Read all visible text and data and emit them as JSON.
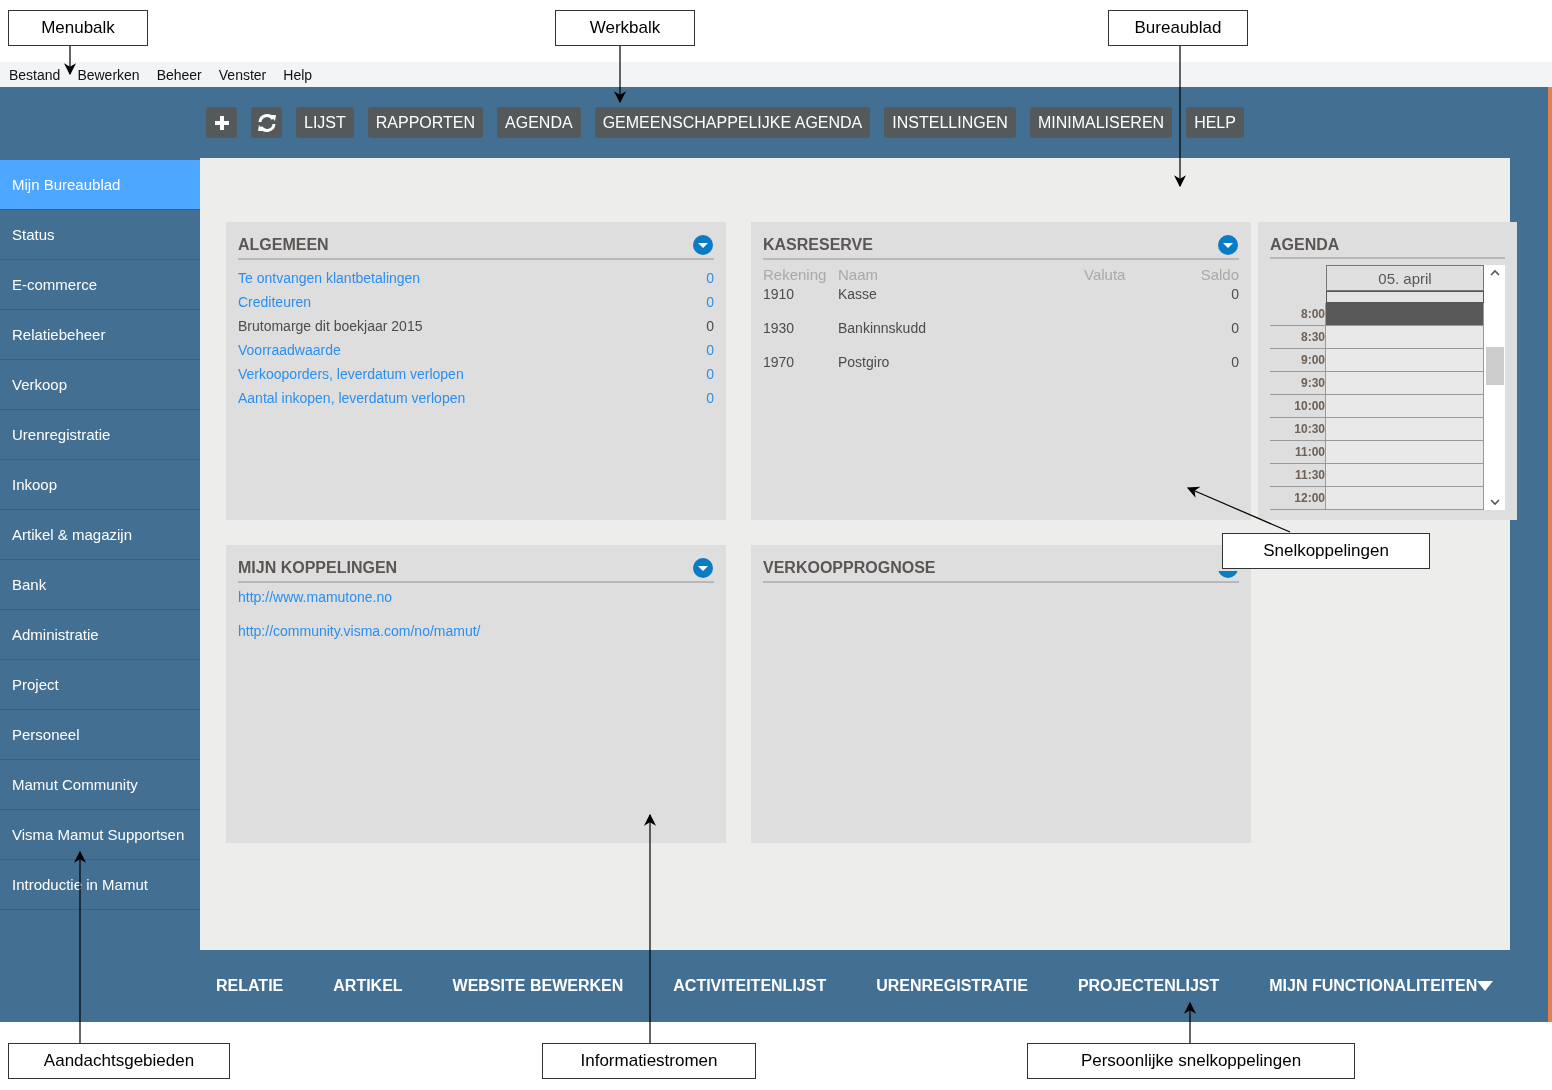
{
  "annotations": [
    {
      "label": "Menubalk"
    },
    {
      "label": "Werkbalk"
    },
    {
      "label": "Bureaublad"
    },
    {
      "label": "Snelkoppelingen"
    },
    {
      "label": "Aandachtsgebieden"
    },
    {
      "label": "Informatiestromen"
    },
    {
      "label": "Persoonlijke snelkoppelingen"
    }
  ],
  "menu_bar": [
    "Bestand",
    "Bewerken",
    "Beheer",
    "Venster",
    "Help"
  ],
  "toolbar": {
    "icon_buttons": [
      {
        "kind": "add"
      },
      {
        "kind": "refresh"
      }
    ],
    "buttons": [
      "LIJST",
      "RAPPORTEN",
      "AGENDA",
      "GEMEENSCHAPPELIJKE AGENDA",
      "INSTELLINGEN",
      "MINIMALISEREN",
      "HELP"
    ]
  },
  "sidebar": {
    "items": [
      {
        "label": "Mijn Bureaublad",
        "selected": true
      },
      {
        "label": "Status",
        "selected": false
      },
      {
        "label": "E-commerce",
        "selected": false
      },
      {
        "label": "Relatiebeheer",
        "selected": false
      },
      {
        "label": "Verkoop",
        "selected": false
      },
      {
        "label": "Urenregistratie",
        "selected": false
      },
      {
        "label": "Inkoop",
        "selected": false
      },
      {
        "label": "Artikel & magazijn",
        "selected": false
      },
      {
        "label": "Bank",
        "selected": false
      },
      {
        "label": "Administratie",
        "selected": false
      },
      {
        "label": "Project",
        "selected": false
      },
      {
        "label": "Personeel",
        "selected": false
      },
      {
        "label": "Mamut Community",
        "selected": false
      },
      {
        "label": "Visma Mamut Supportsen",
        "selected": false
      },
      {
        "label": "Introductie in Mamut",
        "selected": false
      }
    ]
  },
  "algemeen": {
    "title": "ALGEMEEN",
    "rows": [
      {
        "label": "Te ontvangen klantbetalingen",
        "value": "0",
        "link": true
      },
      {
        "label": "Crediteuren",
        "value": "0",
        "link": true
      },
      {
        "label": "Brutomarge dit boekjaar 2015",
        "value": "0",
        "link": false
      },
      {
        "label": "Voorraadwaarde",
        "value": "0",
        "link": true
      },
      {
        "label": "Verkooporders, leverdatum verlopen",
        "value": "0",
        "link": true
      },
      {
        "label": "Aantal inkopen, leverdatum  verlopen",
        "value": "0",
        "link": true
      }
    ]
  },
  "kasreserve": {
    "title": "KASRESERVE",
    "columns": [
      "Rekening",
      "Naam",
      "Valuta",
      "Saldo"
    ],
    "rows": [
      {
        "account": "1910",
        "name": "Kasse",
        "balance": "0"
      },
      {
        "account": "1930",
        "name": "Bankinnskudd",
        "balance": "0"
      },
      {
        "account": "1970",
        "name": "Postgiro",
        "balance": "0"
      }
    ]
  },
  "agenda": {
    "title": "AGENDA",
    "date": "05. april",
    "slots": [
      {
        "time": "8:00",
        "selected": true
      },
      {
        "time": "8:30",
        "selected": false
      },
      {
        "time": "9:00",
        "selected": false
      },
      {
        "time": "9:30",
        "selected": false
      },
      {
        "time": "10:00",
        "selected": false
      },
      {
        "time": "10:30",
        "selected": false
      },
      {
        "time": "11:00",
        "selected": false
      },
      {
        "time": "11:30",
        "selected": false
      },
      {
        "time": "12:00",
        "selected": false
      }
    ]
  },
  "mijn_koppelingen": {
    "title": "MIJN KOPPELINGEN",
    "links": [
      "http://www.mamutone.no",
      "http://community.visma.com/no/mamut/"
    ]
  },
  "verkoopprognose": {
    "title": "VERKOOPPROGNOSE"
  },
  "bottom_links": [
    {
      "label": "RELATIE",
      "has_menu": false
    },
    {
      "label": "ARTIKEL",
      "has_menu": false
    },
    {
      "label": "WEBSITE BEWERKEN",
      "has_menu": false
    },
    {
      "label": "ACTIVITEITENLIJST",
      "has_menu": false
    },
    {
      "label": "URENREGISTRATIE",
      "has_menu": false
    },
    {
      "label": "PROJECTENLIJST",
      "has_menu": false
    },
    {
      "label": "MIJN FUNCTIONALITEITEN",
      "has_menu": true
    }
  ]
}
